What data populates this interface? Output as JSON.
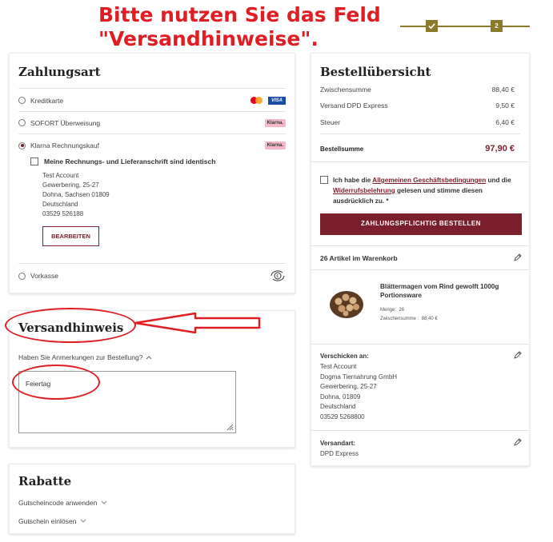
{
  "annotation": {
    "line1": "Bitte nutzen Sie das Feld",
    "line2": "\"Versandhinweise\"."
  },
  "steps": {
    "step1_icon": "check-icon",
    "step2_label": "2"
  },
  "payment": {
    "title": "Zahlungsart",
    "options": [
      {
        "label": "Kreditkarte",
        "selected": false
      },
      {
        "label": "SOFORT Überweisung",
        "selected": false,
        "badge": "Klarna."
      },
      {
        "label": "Klarna Rechnungskauf",
        "selected": true,
        "badge": "Klarna."
      },
      {
        "label": "Vorkasse",
        "selected": false
      }
    ],
    "visa_label": "VISA",
    "same_address_label": "Meine Rechnungs- und Lieferanschrift sind identisch",
    "address": [
      "Test Account",
      "Gewerbering, 25-27",
      "Dohna, Sachsen 01809",
      "Deutschland",
      "03529 526188"
    ],
    "edit_button": "BEARBEITEN"
  },
  "shipping_note": {
    "title": "Versandhinweis",
    "toggle_label": "Haben Sie Anmerkungen zur Bestellung?",
    "textarea_value": "Feiertag"
  },
  "discounts": {
    "title": "Rabatte",
    "coupon_label": "Gutscheincode anwenden",
    "voucher_label": "Gutschein einlösen"
  },
  "summary": {
    "title": "Bestellübersicht",
    "rows": [
      {
        "label": "Zwischensumme",
        "value": "88,40 €"
      },
      {
        "label": "Versand DPD Express",
        "value": "9,50 €"
      },
      {
        "label": "Steuer",
        "value": "6,40 €"
      }
    ],
    "total_label": "Bestellsumme",
    "total_value": "97,90 €",
    "terms_prefix": "Ich habe die ",
    "terms_link1": "Allgemeinen Geschäftsbedingungen",
    "terms_mid": " und die ",
    "terms_link2": "Widerrufsbelehrung",
    "terms_suffix": " gelesen und stimme diesen ausdrücklich zu. *",
    "order_button": "ZAHLUNGSPFLICHTIG BESTELLEN",
    "cart_count": "26 Artikel im Warenkorb",
    "product_name": "Blättermagen vom Rind gewolft 1000g Portionsware",
    "qty_label": "Menge:",
    "qty_value": "26",
    "subtotal_label": "Zwischensumme :",
    "subtotal_value": "88,40 €",
    "ship_to_label": "Verschicken an:",
    "ship_to": [
      "Test Account",
      "Dogma Tiernahrung GmbH",
      "Gewerbering, 25-27",
      "Dohna, 01809",
      "Deutschland",
      "03529 5268800"
    ],
    "ship_method_label": "Versandart:",
    "ship_method_value": "DPD Express"
  },
  "colors": {
    "accent": "#7a1f2b",
    "annotation_red": "#e11d24",
    "gold": "#8c7a2b"
  }
}
